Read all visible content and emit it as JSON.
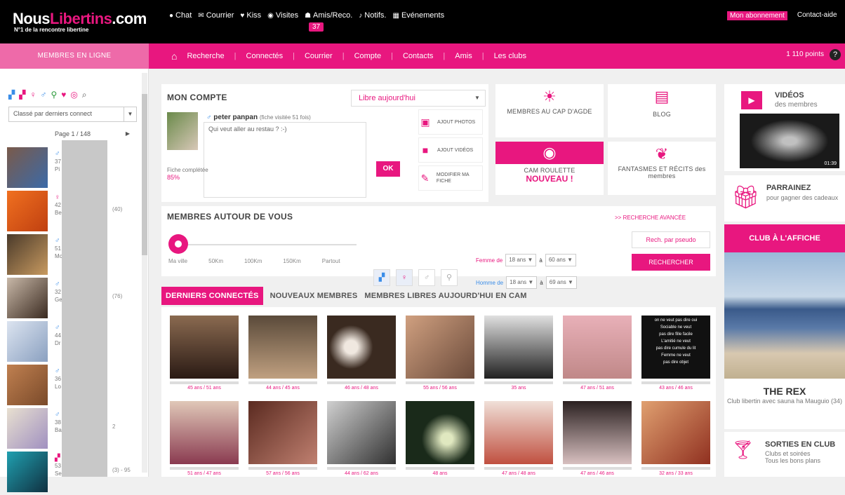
{
  "brand": {
    "part1": "Nous",
    "part2": "Libertins",
    "part3": ".com",
    "tagline": "N°1 de la rencontre libertine"
  },
  "topnav": [
    {
      "icon": "chat-icon",
      "label": "Chat"
    },
    {
      "icon": "mail-icon",
      "label": "Courrier"
    },
    {
      "icon": "kiss-icon",
      "label": "Kiss"
    },
    {
      "icon": "eye-icon",
      "label": "Visites"
    },
    {
      "icon": "friends-icon",
      "label": "Amis/Reco."
    },
    {
      "icon": "bell-icon",
      "label": "Notifs."
    },
    {
      "icon": "calendar-icon",
      "label": "Evénements"
    }
  ],
  "visits_count": "37",
  "account_links": {
    "abonnement": "Mon abonnement",
    "contact": "Contact-aide"
  },
  "mainnav": [
    "Recherche",
    "Connectés",
    "Courrier",
    "Compte",
    "Contacts",
    "Amis",
    "Les clubs"
  ],
  "points": "1 110 points",
  "help": "?",
  "sidebar": {
    "title": "MEMBRES EN LIGNE",
    "sort_label": "Classé par derniers connect",
    "pager": "Page 1 / 148",
    "members": [
      {
        "line1": "37",
        "line2": "Pi",
        "extra": ""
      },
      {
        "line1": "42",
        "line2": "Be",
        "extra": "(40)"
      },
      {
        "line1": "51",
        "line2": "Mo",
        "extra": ""
      },
      {
        "line1": "32",
        "line2": "Ge",
        "extra": "(76)"
      },
      {
        "line1": "44",
        "line2": "Dr",
        "extra": ""
      },
      {
        "line1": "36",
        "line2": "Lo",
        "extra": ""
      },
      {
        "line1": "38",
        "line2": "Ba",
        "extra": "2"
      },
      {
        "line1": "53",
        "line2": "Se",
        "extra": "(3) - 95"
      }
    ]
  },
  "mon_compte": {
    "title": "MON COMPTE",
    "status_select": "Libre aujourd'hui",
    "username": "peter panpan",
    "viewed": "(fiche visitée 51 fois)",
    "status_text": "Qui veut aller au restau ? :-)",
    "ok": "OK",
    "fiche_label": "Fiche complétée",
    "fiche_pct": "85%",
    "actions": [
      "AJOUT PHOTOS",
      "AJOUT VIDÉOS",
      "MODIFIER MA FICHE"
    ]
  },
  "tiles": [
    {
      "label": "MEMBRES AU CAP D'AGDE"
    },
    {
      "label": "BLOG"
    },
    {
      "label": "CAM ROULETTE",
      "badge": "NOUVEAU !"
    },
    {
      "label": "FANTASMES ET RÉCITS des membres"
    }
  ],
  "autour": {
    "title": "MEMBRES AUTOUR DE VOUS",
    "advanced": ">> RECHERCHE AVANCÉE",
    "distances": [
      "Ma ville",
      "50Km",
      "100Km",
      "150Km",
      "Partout"
    ],
    "femme_label": "Femme de",
    "homme_label": "Homme de",
    "age_from": "18 ans",
    "age_to": "60 ans",
    "age_to2": "69 ans",
    "sep": "à",
    "pseudo": "Rech. par pseudo",
    "search": "RECHERCHER"
  },
  "tabs": [
    "DERNIERS CONNECTÉS",
    "NOUVEAUX MEMBRES",
    "MEMBRES LIBRES AUJOURD'HUI EN CAM"
  ],
  "photos_row1": [
    "45 ans / 51 ans",
    "44 ans / 45 ans",
    "46 ans / 48 ans",
    "55 ans / 56 ans",
    "35 ans",
    "47 ans / 51 ans",
    "43 ans / 46 ans"
  ],
  "photos_row2": [
    "51 ans / 47 ans",
    "57 ans / 56 ans",
    "44 ans / 62 ans",
    "48 ans",
    "47 ans / 48 ans",
    "47 ans / 46 ans",
    "32 ans / 33 ans"
  ],
  "photo_overlay_text": [
    "on ne veut pas dire oui",
    "Sociable ne veut",
    "pas dire fille facile",
    "L'amitié ne veut",
    "pas dire cumule du lit",
    "Femme ne veut",
    "pas dire objet"
  ],
  "right": {
    "videos_title": "VIDÉOS",
    "videos_sub": "des membres",
    "video_time": "01:39",
    "parr_title": "PARRAINEZ",
    "parr_sub": "pour gagner des cadeaux",
    "club_title": "CLUB À L'AFFICHE",
    "club_name": "THE REX",
    "club_desc": "Club libertin avec sauna ha Mauguio (34)",
    "sorties_title": "SORTIES EN CLUB",
    "sorties_sub1": "Clubs et soirées",
    "sorties_sub2": "Tous les bons plans"
  },
  "colors": {
    "accent": "#e8177f",
    "topbar": "#000000",
    "bg": "#f0f0f0"
  }
}
